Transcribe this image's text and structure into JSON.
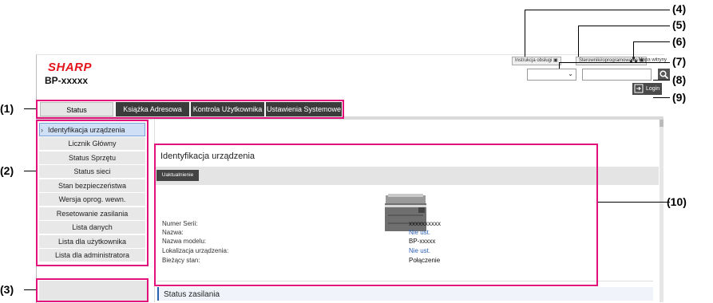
{
  "header": {
    "logo": "SHARP",
    "model": "BP-xxxxx",
    "manual_btn": "Instrukcja obsługi",
    "driver_btn": "Sterowniki/oprogramowanie",
    "sitemap_link": "Mapa witryny",
    "login_btn": "Login"
  },
  "tabs": [
    "Status",
    "Książka Adresowa",
    "Kontrola Użytkownika",
    "Ustawienia Systemowe"
  ],
  "sidebar": {
    "items": [
      "Identyfikacja urządzenia",
      "Licznik Główny",
      "Status Sprzętu",
      "Status sieci",
      "Stan bezpieczeństwa",
      "Wersja oprog. wewn.",
      "Resetowanie zasilania",
      "Lista danych",
      "Lista dla użytkownika",
      "Lista dla administratora"
    ]
  },
  "main": {
    "title": "Identyfikacja urządzenia",
    "refresh_btn": "Uaktualnienie",
    "fields": [
      {
        "label": "Numer Serii:",
        "value": "xxxxxxxxxx"
      },
      {
        "label": "Nazwa:",
        "value": "Nie ust."
      },
      {
        "label": "Nazwa modelu:",
        "value": "BP-xxxxx"
      },
      {
        "label": "Lokalizacja urządzenia:",
        "value": "Nie ust."
      },
      {
        "label": "Bieżący stan:",
        "value": "Połączenie"
      }
    ],
    "power_status": "Status zasilania"
  },
  "callouts": [
    "(1)",
    "(2)",
    "(3)",
    "(4)",
    "(5)",
    "(6)",
    "(7)",
    "(8)",
    "(9)",
    "(10)"
  ],
  "colors": {
    "callout": "#e0117a",
    "logo": "#e3141b",
    "link": "#2b5fb3",
    "tab_dark": "#3b3b3b"
  }
}
